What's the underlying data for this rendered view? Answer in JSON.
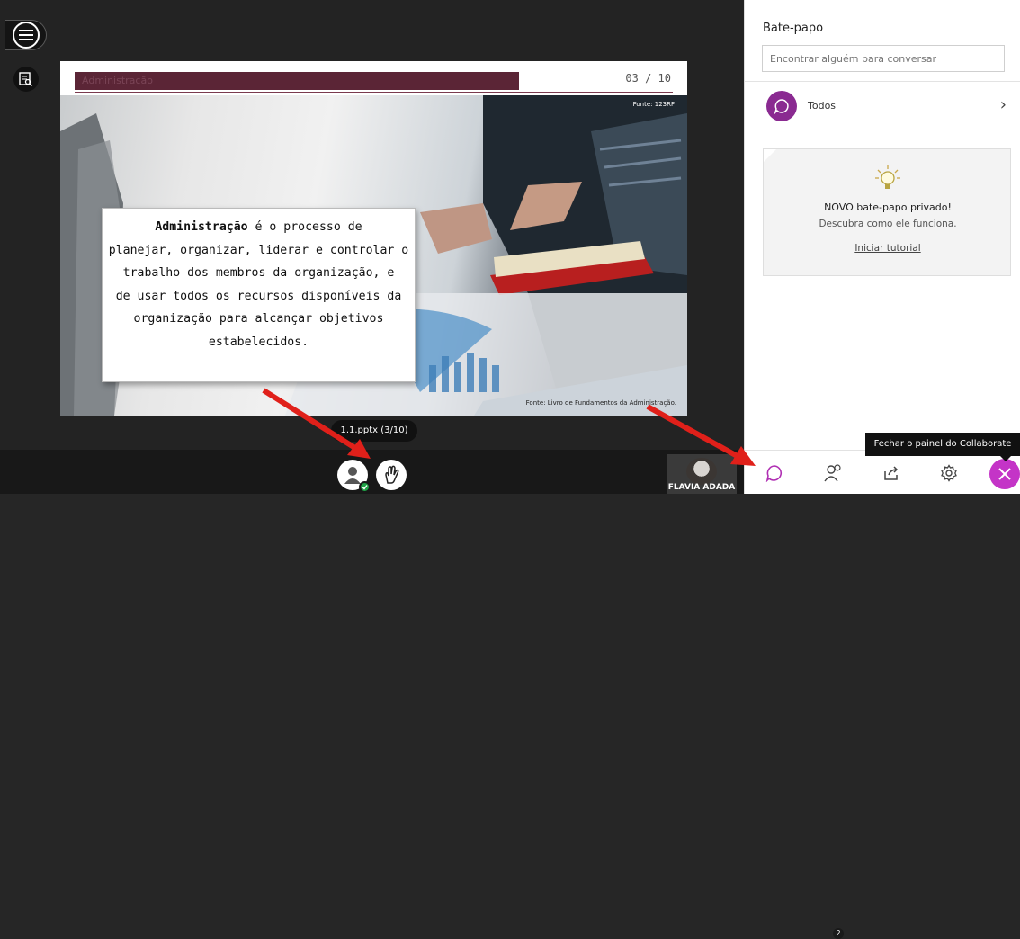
{
  "slide": {
    "title": "Administração",
    "page_indicator": "03 / 10",
    "credit_top": "Fonte: 123RF",
    "credit_bottom": "Fonte: Livro de Fundamentos da Administração.",
    "text": {
      "bold_lead": "Administração",
      "line1_rest": " é o processo de",
      "underlined": "planejar, organizar, liderar e controlar",
      "line2_rest": " o",
      "line3": "trabalho dos membros da organização, e",
      "line4": "de usar todos os recursos disponíveis da",
      "line5": "organização para alcançar objetivos",
      "line6": "estabelecidos."
    }
  },
  "file_pill": "1.1.pptx (3/10)",
  "camera": {
    "name": "FLAVIA ADADA"
  },
  "panel": {
    "title": "Bate-papo",
    "search_placeholder": "Encontrar alguém para conversar",
    "everyone_label": "Todos",
    "tip": {
      "title": "NOVO bate-papo privado!",
      "subtitle": "Descubra como ele funciona.",
      "link": "Iniciar tutorial"
    },
    "tooltip": "Fechar o painel do Collaborate",
    "participants_badge": "2"
  },
  "colors": {
    "accent": "#c434c7",
    "chat_icon_bg": "#8a2a91",
    "title_bar": "#5b2536",
    "arrow": "#e0201a"
  }
}
